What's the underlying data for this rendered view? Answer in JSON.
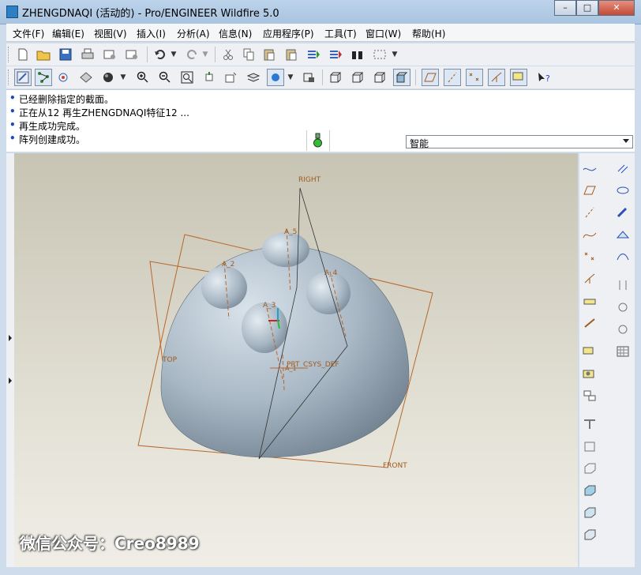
{
  "window": {
    "title": "ZHENGDNAQI (活动的) - Pro/ENGINEER Wildfire 5.0"
  },
  "menu": [
    "文件(F)",
    "编辑(E)",
    "视图(V)",
    "插入(I)",
    "分析(A)",
    "信息(N)",
    "应用程序(P)",
    "工具(T)",
    "窗口(W)",
    "帮助(H)"
  ],
  "messages": [
    "已经删除指定的截面。",
    "正在从12 再生ZHENGDNAQI特征12 ...",
    "再生成功完成。",
    "阵列创建成功。"
  ],
  "filter": {
    "value": "智能"
  },
  "model_labels": {
    "right": "RIGHT",
    "top": "TOP",
    "front": "FRONT",
    "csys": "PRT_CSYS_DEF",
    "a2": "A_2",
    "a3": "A_3",
    "a4": "A_4",
    "a5": "A_5",
    "a1": "A_1"
  },
  "watermark": "微信公众号：Creo8989",
  "colors": {
    "title_bar": "#bcd3ea",
    "viewport_top": "#c7c4b4",
    "model": "#b3c0cb",
    "datum": "#b8672a"
  }
}
